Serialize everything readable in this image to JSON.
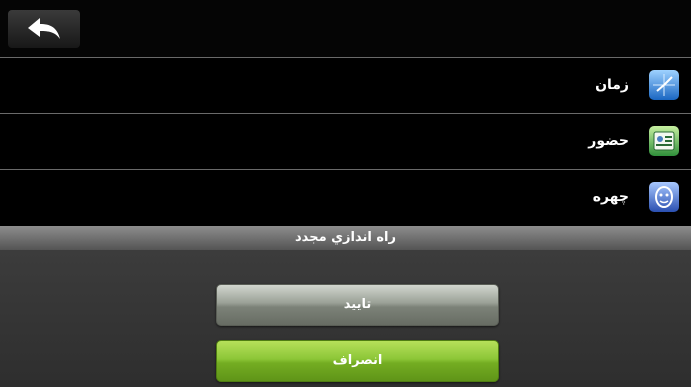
{
  "topbar": {
    "back_icon": "back-arrow-icon"
  },
  "menu": {
    "items": [
      {
        "label": "زمان",
        "icon": "clock-icon"
      },
      {
        "label": "حضور",
        "icon": "attendance-icon"
      },
      {
        "label": "چهره",
        "icon": "face-icon"
      }
    ]
  },
  "dialog": {
    "title": "راه اندازي مجدد",
    "confirm_label": "تاييد",
    "cancel_label": "انصراف"
  },
  "colors": {
    "confirm_button": "#8a9086",
    "cancel_button": "#7fb82c",
    "icon_blue": "#2e7fd0"
  }
}
